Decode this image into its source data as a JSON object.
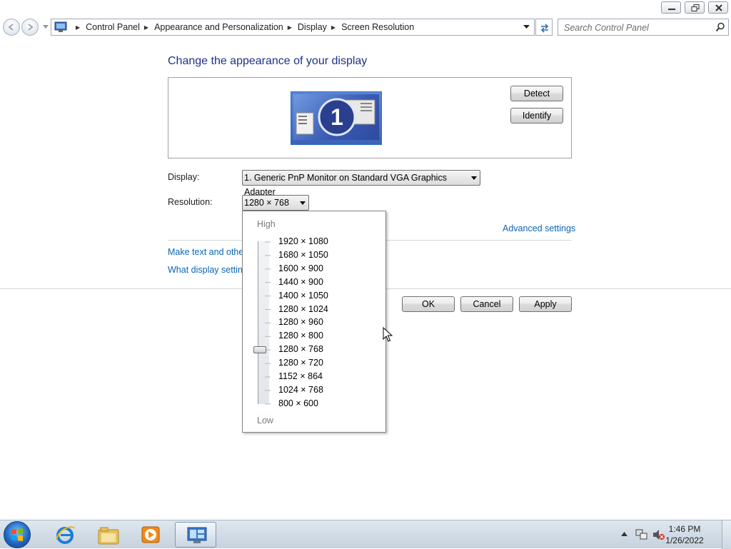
{
  "window": {
    "caption_buttons": [
      "minimize-icon",
      "restore-icon",
      "close-icon"
    ]
  },
  "address_bar": {
    "breadcrumbs": [
      "Control Panel",
      "Appearance and Personalization",
      "Display",
      "Screen Resolution"
    ],
    "search_placeholder": "Search Control Panel"
  },
  "main": {
    "title": "Change the appearance of your display",
    "monitor_number": "1",
    "detect_label": "Detect",
    "identify_label": "Identify",
    "display_label": "Display:",
    "display_value": "1. Generic PnP Monitor on Standard VGA Graphics Adapter",
    "resolution_label": "Resolution:",
    "resolution_value": "1280 × 768",
    "advanced_settings": "Advanced settings",
    "link_text_size": "Make text and other",
    "link_display_settings": "What display setting",
    "ok_label": "OK",
    "cancel_label": "Cancel",
    "apply_label": "Apply"
  },
  "resolution_dropdown": {
    "high_label": "High",
    "low_label": "Low",
    "options": [
      "1920 × 1080",
      "1680 × 1050",
      "1600 × 900",
      "1440 × 900",
      "1400 × 1050",
      "1280 × 1024",
      "1280 × 960",
      "1280 × 800",
      "1280 × 768",
      "1280 × 720",
      "1152 × 864",
      "1024 × 768",
      "800 × 600"
    ],
    "selected_index": 8
  },
  "taskbar": {
    "apps": [
      "internet-explorer-icon",
      "file-explorer-icon",
      "media-player-icon",
      "control-panel-icon"
    ],
    "time": "1:46 PM",
    "date": "1/26/2022"
  },
  "colors": {
    "title_blue": "#1e3287",
    "link_blue": "#0a64b4"
  }
}
